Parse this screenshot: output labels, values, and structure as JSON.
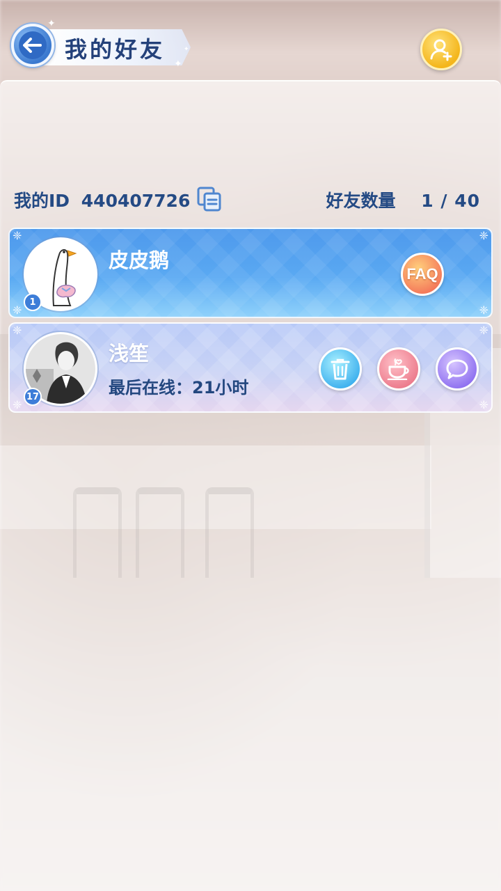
{
  "header": {
    "title": "我的好友",
    "back_icon": "arrow-left-icon",
    "add_friend_icon": "add-user-icon"
  },
  "info": {
    "my_id_label": "我的ID",
    "my_id_value": "440407726",
    "copy_icon": "copy-icon",
    "friend_count_label": "好友数量",
    "friend_count_value": "1 / 40"
  },
  "friends": [
    {
      "name": "皮皮鹅",
      "level": "1",
      "avatar": "goose-avatar",
      "is_self": true,
      "action": "FAQ"
    },
    {
      "name": "浅笙",
      "level": "17",
      "avatar": "portrait-avatar",
      "last_online_label": "最后在线：",
      "last_online_value": "21小时",
      "actions": [
        "delete-icon",
        "coffee-icon",
        "chat-icon"
      ]
    }
  ],
  "colors": {
    "title_text": "#24417a",
    "label_text": "#244a84",
    "self_card": "#5aa9f2",
    "friend_card": "#c8d2f5",
    "add_button": "#f4b61c"
  }
}
